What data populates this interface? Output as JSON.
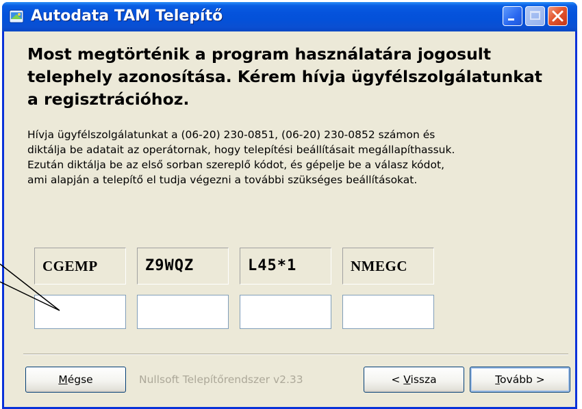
{
  "window": {
    "title": "Autodata TAM Telepítő",
    "icon": "installer-icon",
    "controls": [
      "minimize-icon",
      "maximize-icon",
      "close-icon"
    ]
  },
  "heading": "Most megtörténik a program használatára jogosult telephely azonosítása. Kérem hívja ügyfélszolgálatunkat a regisztrációhoz.",
  "description": "Hívja ügyfélszolgálatunkat a (06-20) 230-0851, (06-20) 230-0852 számon és\ndiktálja be adatait az operátornak, hogy telepítési beállításait megállapíthassuk.\nEzután diktálja be az első sorban szereplő kódot, és gépelje be a válasz kódot,\nami alapján a telepítő el tudja végezni a további szükséges beállításokat.",
  "codes": [
    "CGEMP",
    "Z9WQZ",
    "L45*1",
    "NMEGC"
  ],
  "answers": [
    "",
    "",
    "",
    ""
  ],
  "footer": {
    "branding": "Nullsoft Telepítőrendszer v2.33",
    "cancel": {
      "mnemonic": "M",
      "rest": "égse"
    },
    "back": {
      "prefix": "< ",
      "mnemonic": "V",
      "rest": "issza"
    },
    "next": {
      "mnemonic": "T",
      "rest": "ovább >"
    }
  },
  "colors": {
    "titlebar": "#0553dc",
    "window_bg": "#ece9d8",
    "border": "#0831d9",
    "branding_text": "#aca899"
  }
}
